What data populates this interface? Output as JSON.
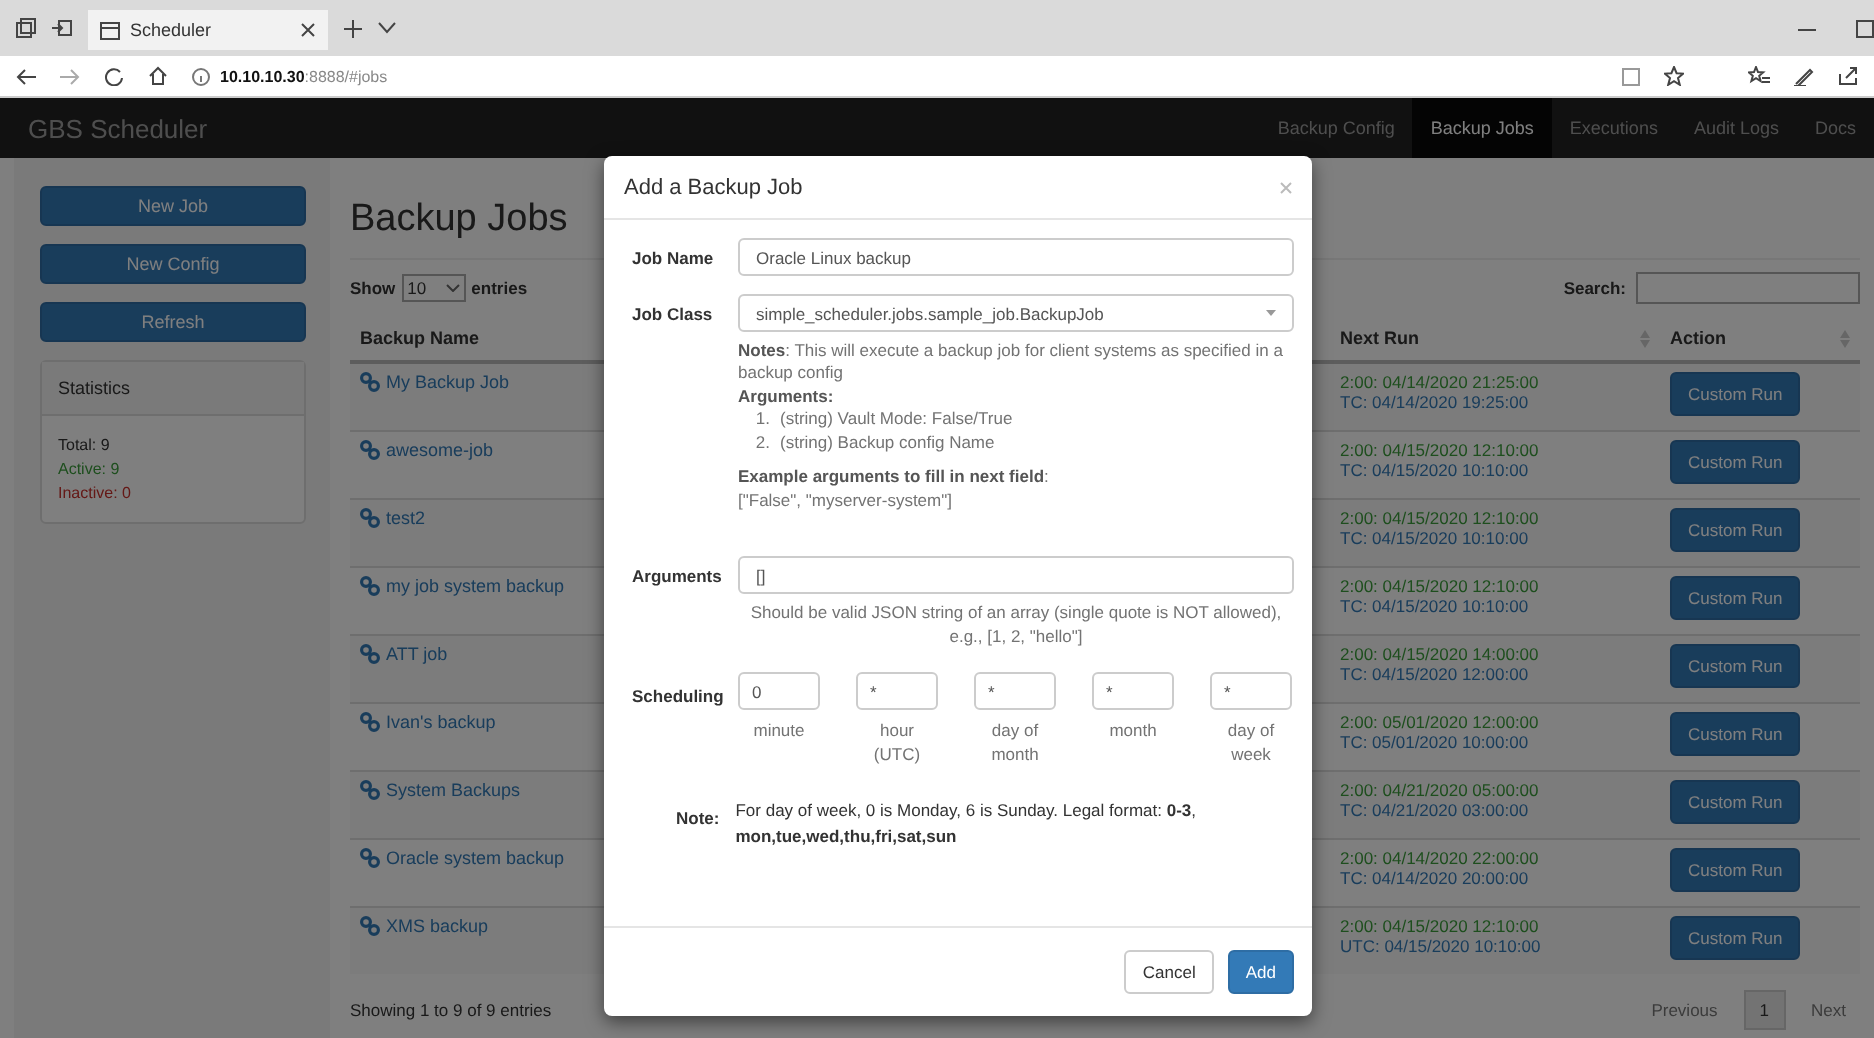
{
  "browser": {
    "tab_title": "Scheduler",
    "url_host": "10.10.10.30",
    "url_rest": ":8888/#jobs"
  },
  "navbar": {
    "brand": "GBS Scheduler",
    "links": [
      {
        "label": "Backup Config",
        "selected": false
      },
      {
        "label": "Backup Jobs",
        "selected": true
      },
      {
        "label": "Executions",
        "selected": false
      },
      {
        "label": "Audit Logs",
        "selected": false
      },
      {
        "label": "Docs",
        "selected": false
      }
    ]
  },
  "sidebar": {
    "buttons": [
      "New Job",
      "New Config",
      "Refresh"
    ],
    "statistics": {
      "title": "Statistics",
      "total": "Total: 9",
      "active": "Active: 9",
      "inactive": "Inactive: 0"
    }
  },
  "main": {
    "title": "Backup Jobs",
    "length": {
      "show": "Show",
      "value": "10",
      "entries": "entries"
    },
    "search_label": "Search:",
    "columns": [
      "Backup Name",
      "Next Run",
      "Action"
    ],
    "rows": [
      {
        "name": "My Backup Job",
        "next_local": "2:00: 04/14/2020 21:25:00",
        "next_utc": "TC: 04/14/2020 19:25:00",
        "action": "Custom Run"
      },
      {
        "name": "awesome-job",
        "next_local": "2:00: 04/15/2020 12:10:00",
        "next_utc": "TC: 04/15/2020 10:10:00",
        "action": "Custom Run"
      },
      {
        "name": "test2",
        "next_local": "2:00: 04/15/2020 12:10:00",
        "next_utc": "TC: 04/15/2020 10:10:00",
        "action": "Custom Run"
      },
      {
        "name": "my job system backup",
        "next_local": "2:00: 04/15/2020 12:10:00",
        "next_utc": "TC: 04/15/2020 10:10:00",
        "action": "Custom Run"
      },
      {
        "name": "ATT job",
        "next_local": "2:00: 04/15/2020 14:00:00",
        "next_utc": "TC: 04/15/2020 12:00:00",
        "action": "Custom Run"
      },
      {
        "name": "Ivan's backup",
        "next_local": "2:00: 05/01/2020 12:00:00",
        "next_utc": "TC: 05/01/2020 10:00:00",
        "action": "Custom Run"
      },
      {
        "name": "System Backups",
        "next_local": "2:00: 04/21/2020 05:00:00",
        "next_utc": "TC: 04/21/2020 03:00:00",
        "action": "Custom Run"
      },
      {
        "name": "Oracle system backup",
        "next_local": "2:00: 04/14/2020 22:00:00",
        "next_utc": "TC: 04/14/2020 20:00:00",
        "action": "Custom Run"
      },
      {
        "name": "XMS backup",
        "next_local": "2:00: 04/15/2020 12:10:00",
        "next_utc": "UTC: 04/15/2020 10:10:00",
        "action": "Custom Run"
      }
    ],
    "info": "Showing 1 to 9 of 9 entries",
    "pagination": {
      "previous": "Previous",
      "pages": [
        {
          "label": "1",
          "selected": true
        }
      ],
      "next": "Next"
    }
  },
  "modal": {
    "title": "Add a Backup Job",
    "job_name": {
      "label": "Job Name",
      "value": "Oracle Linux backup"
    },
    "job_class": {
      "label": "Job Class",
      "value": "simple_scheduler.jobs.sample_job.BackupJob"
    },
    "notes": "**Notes**: This will execute a backup job for client systems as specified in a backup config",
    "arguments_heading": "Arguments:",
    "arguments_list": [
      {
        "marker": "1.",
        "text": "(string) Vault Mode: False/True"
      },
      {
        "marker": "2.",
        "text": "(string) Backup config Name"
      }
    ],
    "example_heading": "**Example arguments to fill in next field**:",
    "example_value": "[\"False\", \"myserver-system\"]",
    "arguments": {
      "label": "Arguments",
      "value": "[]",
      "help": "Should be valid JSON string of an array (single quote is NOT allowed), e.g., [1, 2, \"hello\"]"
    },
    "scheduling": {
      "label": "Scheduling",
      "fields": [
        {
          "value": "0",
          "label": "minute"
        },
        {
          "value": "*",
          "label": "hour (UTC)"
        },
        {
          "value": "*",
          "label": "day of month"
        },
        {
          "value": "*",
          "label": "month"
        },
        {
          "value": "*",
          "label": "day of week"
        }
      ]
    },
    "note_label": "Note:",
    "note": "For day of week, 0 is Monday, 6 is Sunday. Legal format: **0-3**, **mon,tue,wed,thu,fri,sat,sun**",
    "buttons": [
      {
        "label": "Cancel",
        "kind": "default"
      },
      {
        "label": "Add",
        "kind": "primary"
      }
    ]
  }
}
